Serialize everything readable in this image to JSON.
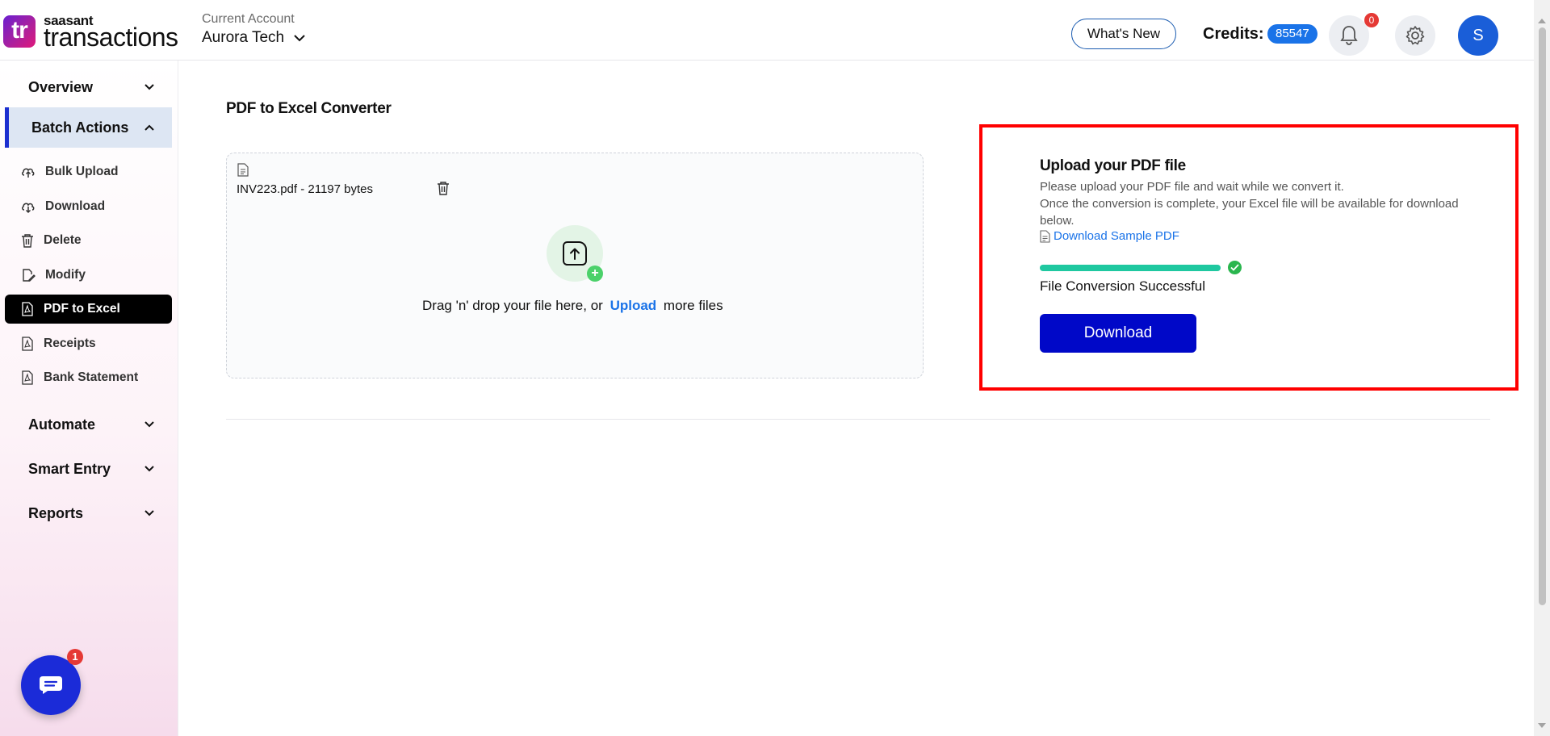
{
  "header": {
    "logo_mark": "tr",
    "logo_small": "saasant",
    "logo_big": "transactions",
    "account_label": "Current Account",
    "account_name": "Aurora Tech",
    "whats_new": "What's New",
    "credits_label": "Credits:",
    "credits_value": "85547",
    "notification_count": "0",
    "avatar_initial": "S"
  },
  "sidebar": {
    "sections": {
      "overview": "Overview",
      "batch_actions": "Batch Actions",
      "automate": "Automate",
      "smart_entry": "Smart Entry",
      "reports": "Reports"
    },
    "items": [
      {
        "label": "Bulk Upload",
        "icon": "cloud-upload-icon"
      },
      {
        "label": "Download",
        "icon": "cloud-download-icon"
      },
      {
        "label": "Delete",
        "icon": "trash-icon"
      },
      {
        "label": "Modify",
        "icon": "edit-file-icon"
      },
      {
        "label": "PDF to Excel",
        "icon": "pdf-icon"
      },
      {
        "label": "Receipts",
        "icon": "pdf-icon"
      },
      {
        "label": "Bank Statement",
        "icon": "pdf-icon"
      }
    ],
    "chat_badge": "1"
  },
  "main": {
    "title": "PDF to Excel Converter",
    "file_name": "INV223.pdf - 21197 bytes",
    "drop_text_before": "Drag 'n' drop your file here, or",
    "drop_link": "Upload",
    "drop_text_after": "more files"
  },
  "panel": {
    "title": "Upload your PDF file",
    "desc_line1": "Please upload your PDF file and wait while we convert it.",
    "desc_line2": "Once the conversion is complete, your Excel file will be available for download below.",
    "sample_link": "Download Sample PDF",
    "progress": 100,
    "status": "File Conversion Successful",
    "download_label": "Download"
  },
  "colors": {
    "accent": "#1a73e8",
    "download_button": "#0008c8",
    "highlight": "#ff0000",
    "progress": "#1fc8a0"
  }
}
